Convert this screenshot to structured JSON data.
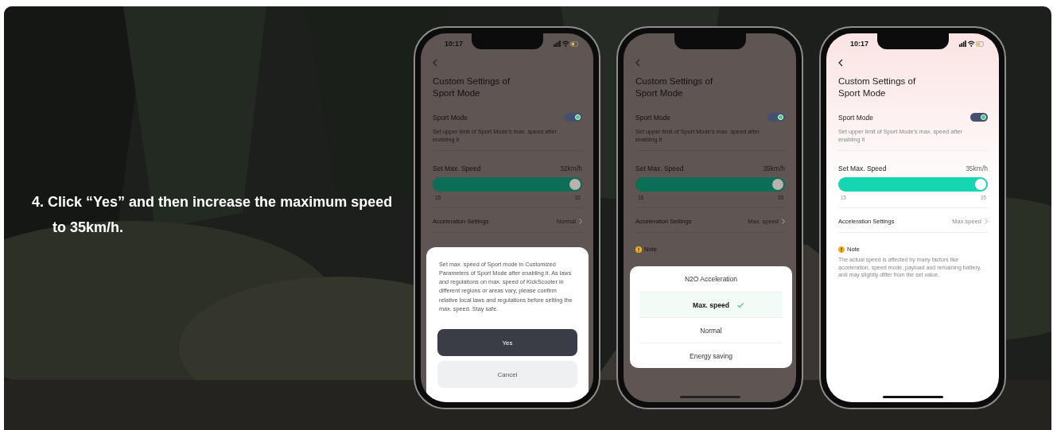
{
  "instruction": "4. Click “Yes” and then increase the maximum speed to 35km/h.",
  "phones": [
    {
      "status_time": "10:17",
      "dimmed": true,
      "title": "Custom Settings of Sport Mode",
      "sport_mode": {
        "label": "Sport Mode",
        "on": true,
        "description": "Set upper limit of Sport Mode's max. speed after enabling it"
      },
      "max_speed": {
        "label": "Set Max. Speed",
        "reading": "32km/h",
        "level": 1,
        "min": "15",
        "max": "32"
      },
      "acceleration": {
        "label": "Acceleration Settings",
        "value": "Normal"
      },
      "overlay": {
        "kind": "dialog",
        "message": "Set max. speed of Sport mode in Customized Parameters of Sport Mode after enabling it. As laws and regulations on max. speed of KickScooter in different regions or areas vary, please confirm relative local laws and regulations before setting the max. speed. Stay safe.",
        "buttons": [
          {
            "label": "Yes",
            "kind": "primary"
          },
          {
            "label": "Cancel",
            "kind": "secondary"
          }
        ]
      }
    },
    {
      "dimmed": true,
      "title": "Custom Settings of Sport Mode",
      "sport_mode": {
        "label": "Sport Mode",
        "on": true,
        "description": "Set upper limit of Sport Mode's max. speed after enabling it"
      },
      "max_speed": {
        "label": "Set Max. Speed",
        "reading": "35km/h",
        "level": 1,
        "min": "15",
        "max": "35"
      },
      "acceleration": {
        "label": "Acceleration Settings",
        "value": "Max. speed"
      },
      "note": {
        "label": "Note"
      },
      "overlay": {
        "kind": "sheet",
        "options": [
          {
            "label": "N2O Acceleration",
            "selected": false
          },
          {
            "label": "Max. speed",
            "selected": true
          },
          {
            "label": "Normal",
            "selected": false
          },
          {
            "label": "Energy saving",
            "selected": false
          }
        ]
      }
    },
    {
      "status_time": "10:17",
      "dimmed": false,
      "title": "Custom Settings of Sport Mode",
      "sport_mode": {
        "label": "Sport Mode",
        "on": true,
        "description": "Set upper limit of Sport Mode's max. speed after enabling it"
      },
      "max_speed": {
        "label": "Set Max. Speed",
        "reading": "35km/h",
        "level": 1,
        "min": "15",
        "max": "35"
      },
      "acceleration": {
        "label": "Acceleration Settings",
        "value": "Max.speed"
      },
      "note": {
        "label": "Note",
        "text": "The actual speed is affected by many factors like acceleration, speed mode, payload and remaining battery, and may slightly differ from the set value."
      }
    }
  ]
}
